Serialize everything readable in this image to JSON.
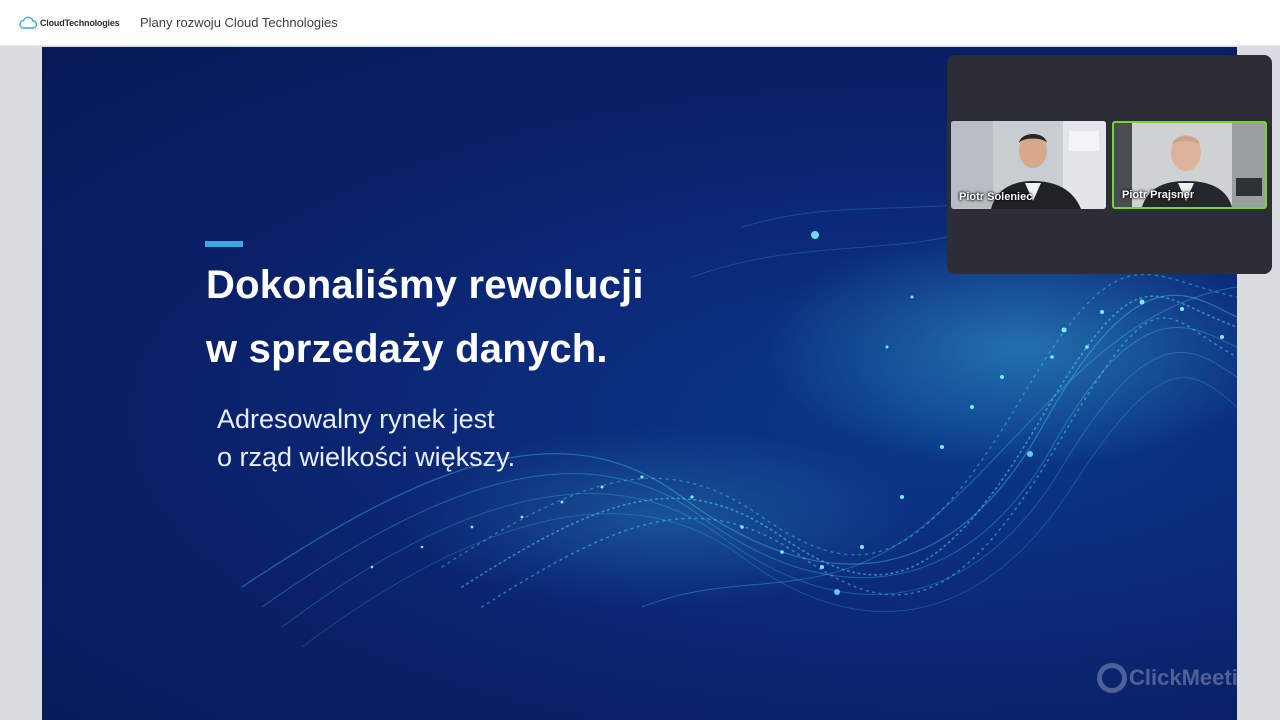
{
  "header": {
    "logo_text": "CloudTechnologies",
    "title": "Plany rozwoju Cloud Technologies"
  },
  "slide": {
    "headline_line1": "Dokonaliśmy rewolucji",
    "headline_line2": "w sprzedaży danych.",
    "sub_line1": "Adresowalny rynek jest",
    "sub_line2": "o rząd wielkości większy.",
    "watermark": "ClickMeeting",
    "colors": {
      "background": "#0b2a79",
      "accent": "#3aa8e6",
      "wave": "#4fe0ff"
    }
  },
  "participants": [
    {
      "name": "Piotr Soleniec",
      "active_speaker": false
    },
    {
      "name": "Piotr Prajsner",
      "active_speaker": true
    }
  ]
}
